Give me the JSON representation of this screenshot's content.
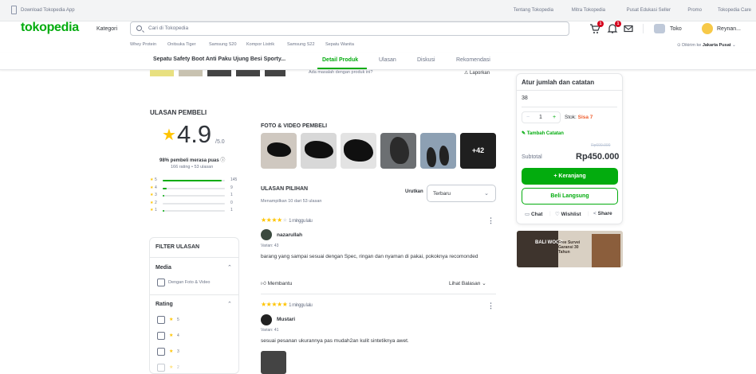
{
  "topbar": {
    "download": "Download Tokopedia App",
    "links": [
      "Tentang Tokopedia",
      "Mitra Tokopedia",
      "Pusat Edukasi Seller",
      "Promo",
      "Tokopedia Care"
    ]
  },
  "header": {
    "logo": "tokopedia",
    "kategori": "Kategori",
    "search_placeholder": "Cari di Tokopedia",
    "cart_badge": "1",
    "notif_badge": "1",
    "toko": "Toko",
    "user": "Reynan..."
  },
  "suggestions": [
    "Whey Protein",
    "Onitsuka Tiger",
    "Samsung S20",
    "Kompor Listrik",
    "Samsung S22",
    "Sepatu Wanita"
  ],
  "location": {
    "label": "Dikirim ke",
    "value": "Jakarta Pusat"
  },
  "tabs": {
    "product_name": "Sepatu Safety Boot Anti Paku Ujung Besi Sporty...",
    "items": [
      "Detail Produk",
      "Ulasan",
      "Diskusi",
      "Rekomendasi"
    ]
  },
  "report": {
    "question": "Ada masalah dengan produk ini?",
    "link": "Laporkan"
  },
  "reviews_summary": {
    "title": "ULASAN PEMBELI",
    "rating": "4.9",
    "out_of": "/5.0",
    "satisfied_bold": "98% pembeli merasa puas",
    "counts": "166 rating • 53 ulasan",
    "distribution": [
      {
        "star": "5",
        "count": "145",
        "fraction": 0.95
      },
      {
        "star": "4",
        "count": "9",
        "fraction": 0.06
      },
      {
        "star": "3",
        "count": "1",
        "fraction": 0.01
      },
      {
        "star": "2",
        "count": "0",
        "fraction": 0.0
      },
      {
        "star": "1",
        "count": "1",
        "fraction": 0.01
      }
    ]
  },
  "filter": {
    "title": "FILTER ULASAN",
    "media_head": "Media",
    "media_option": "Dengan Foto & Video",
    "rating_head": "Rating",
    "rating_options": [
      "5",
      "4",
      "3",
      "2"
    ]
  },
  "photos": {
    "title": "FOTO & VIDEO PEMBELI",
    "more": "+42"
  },
  "pilihan": {
    "title": "ULASAN PILIHAN",
    "showing": "Menampilkan 10 dari 53 ulasan",
    "sort_label": "Urutkan",
    "sort_value": "Terbaru"
  },
  "reviews": [
    {
      "stars": 4,
      "time": "1 minggu lalu",
      "name": "nazarullah",
      "variant": "Varian: 43",
      "text": "barang yang sampai sesuai dengan Spec, ringan dan nyaman di pakai, pokoknya recomonded",
      "helpful": "Membantu",
      "reply": "Lihat Balasan"
    },
    {
      "stars": 5,
      "time": "1 minggu lalu",
      "name": "Mustari",
      "variant": "Varian: 41",
      "text": "sesuai pesanan ukurannya pas mudah2an kulit sintetiknya awet."
    }
  ],
  "purchase": {
    "title": "Atur jumlah dan catatan",
    "variant": "38",
    "qty": "1",
    "stock_label": "Stok:",
    "stock_value": "Sisa 7",
    "note": "Tambah Catatan",
    "strike_price": "Rp600.000",
    "subtotal_label": "Subtotal",
    "subtotal": "Rp450.000",
    "cart_button": "+ Keranjang",
    "buy_button": "Beli Langsung",
    "chat": "Chat",
    "wishlist": "Wishlist",
    "share": "Share"
  },
  "banner": {
    "logo": "BALI WOOD",
    "text": "Free Survei Garansi 30 Tahun"
  },
  "colors": {
    "green": "#03ac0e",
    "star": "#ffc400",
    "orange": "#ef5e2e",
    "badge": "#d6001c"
  }
}
